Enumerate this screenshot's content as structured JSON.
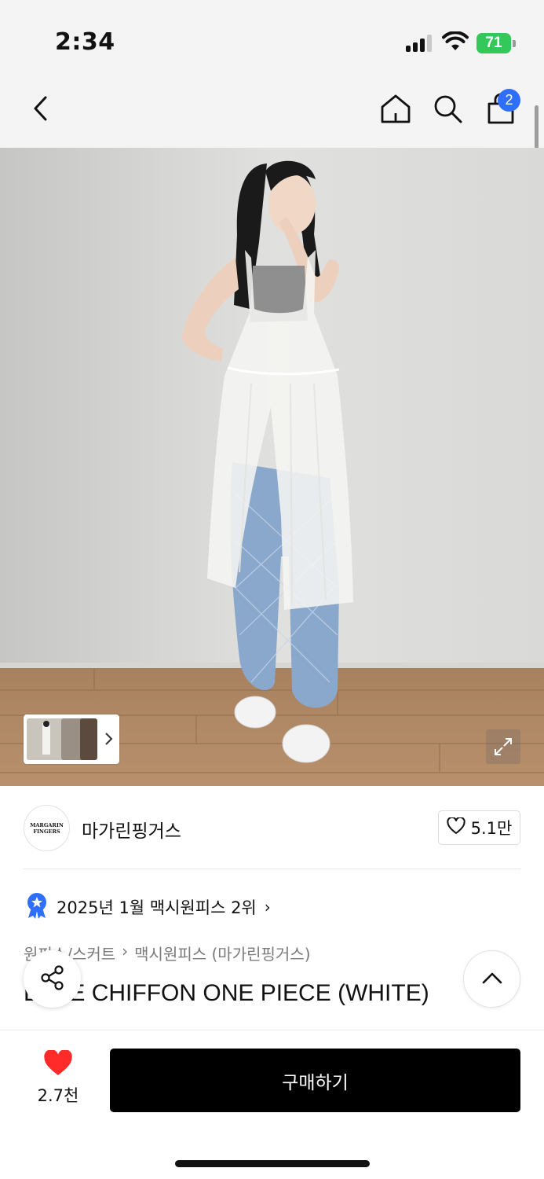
{
  "status_bar": {
    "time": "2:34",
    "battery": "71",
    "battery_color": "#34c759"
  },
  "nav": {
    "icons": [
      "back-icon",
      "home-icon",
      "search-icon",
      "cart-icon"
    ],
    "cart_badge": "2",
    "badge_color": "#2f6fff"
  },
  "gallery": {
    "thumbnail_count": 3,
    "icons": [
      "chevron-right-icon",
      "expand-icon"
    ]
  },
  "brand": {
    "logo_line1": "MARGARIN",
    "logo_line2": "FINGERS",
    "name": "마가린핑거스",
    "like_count": "5.1만"
  },
  "ranking": {
    "text": "2025년 1월 맥시원피스 2위",
    "chevron": "›"
  },
  "breadcrumb": {
    "category": "원피스/스커트",
    "separator": "›",
    "subcategory": "맥시원피스 (마가린핑거스)"
  },
  "product": {
    "title": "LACE CHIFFON ONE PIECE (WHITE)"
  },
  "bottom_bar": {
    "heart_count": "2.7천",
    "heart_color": "#ff2a2a",
    "buy_label": "구매하기"
  }
}
